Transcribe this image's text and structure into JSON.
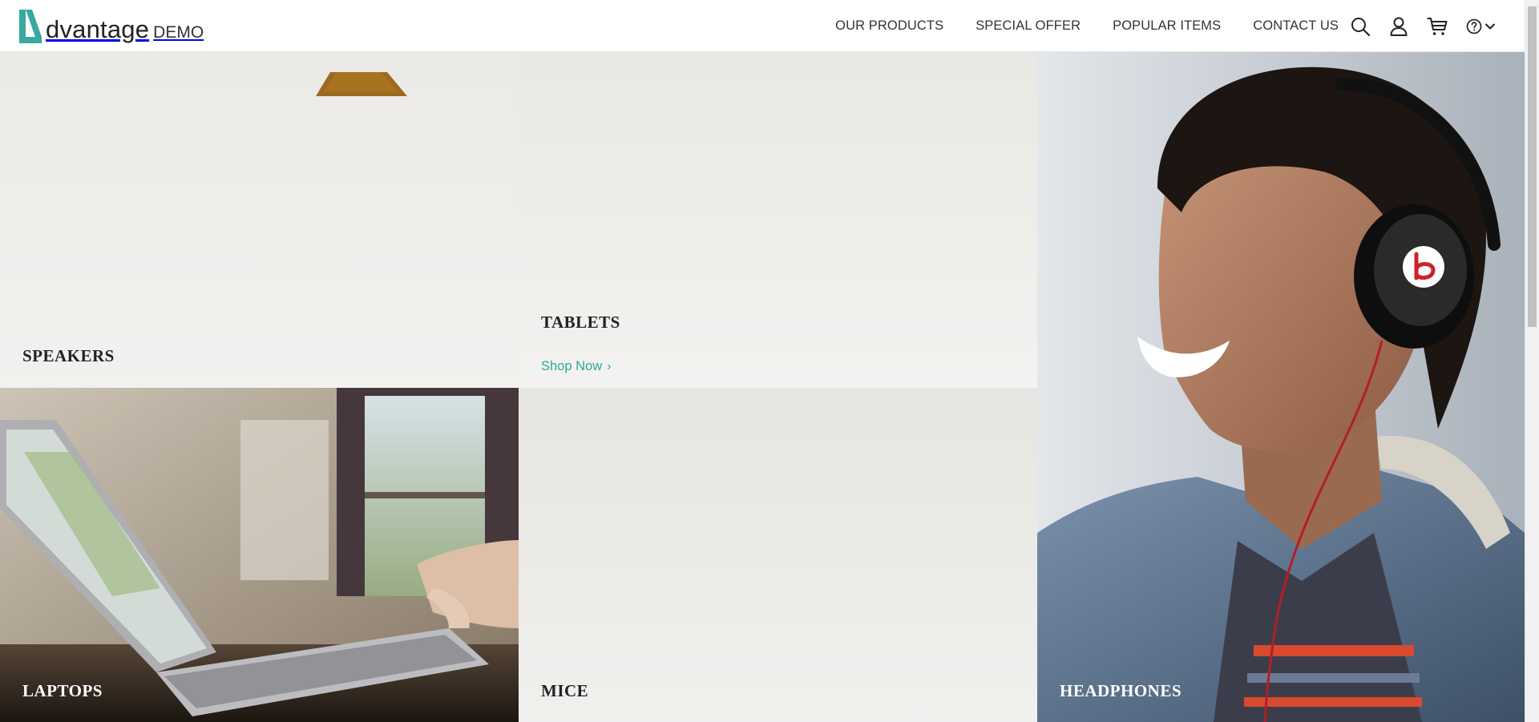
{
  "logo": {
    "word": "dvantage",
    "suffix": "DEMO"
  },
  "nav": {
    "items": [
      "OUR PRODUCTS",
      "SPECIAL OFFER",
      "POPULAR ITEMS",
      "CONTACT US"
    ]
  },
  "header_icons": [
    "search-icon",
    "user-icon",
    "cart-icon",
    "help-icon",
    "chevron-down-icon"
  ],
  "categories": {
    "speakers": {
      "title": "SPEAKERS"
    },
    "tablets": {
      "title": "TABLETS",
      "cta": "Shop Now"
    },
    "laptops": {
      "title": "LAPTOPS"
    },
    "mice": {
      "title": "MICE"
    },
    "headphones": {
      "title": "HEADPHONES"
    }
  },
  "colors": {
    "accent": "#2eaa99",
    "brand_teal": "#3aa9a0",
    "text": "#222222"
  }
}
